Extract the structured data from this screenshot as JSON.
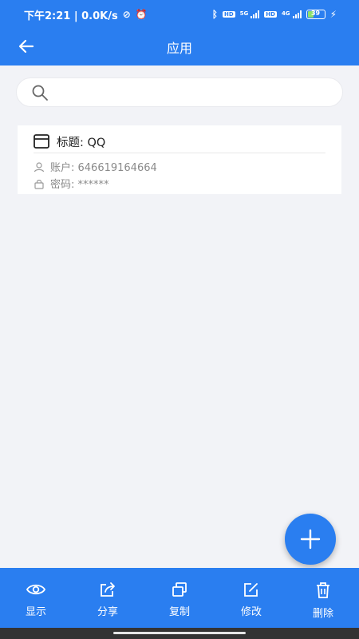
{
  "status": {
    "time_speed": "下午2:21 | 0.0K/s",
    "net1": "5G",
    "net2": "4G",
    "hd": "HD",
    "battery": "39"
  },
  "header": {
    "title": "应用"
  },
  "search": {
    "placeholder": ""
  },
  "entry": {
    "title": "标题: QQ",
    "account": "账户: 646619164664",
    "password": "密码: ******"
  },
  "toolbar": {
    "show": "显示",
    "share": "分享",
    "copy": "复制",
    "edit": "修改",
    "delete": "删除"
  },
  "colors": {
    "primary": "#2a7ef0",
    "background": "#f2f3f7"
  }
}
